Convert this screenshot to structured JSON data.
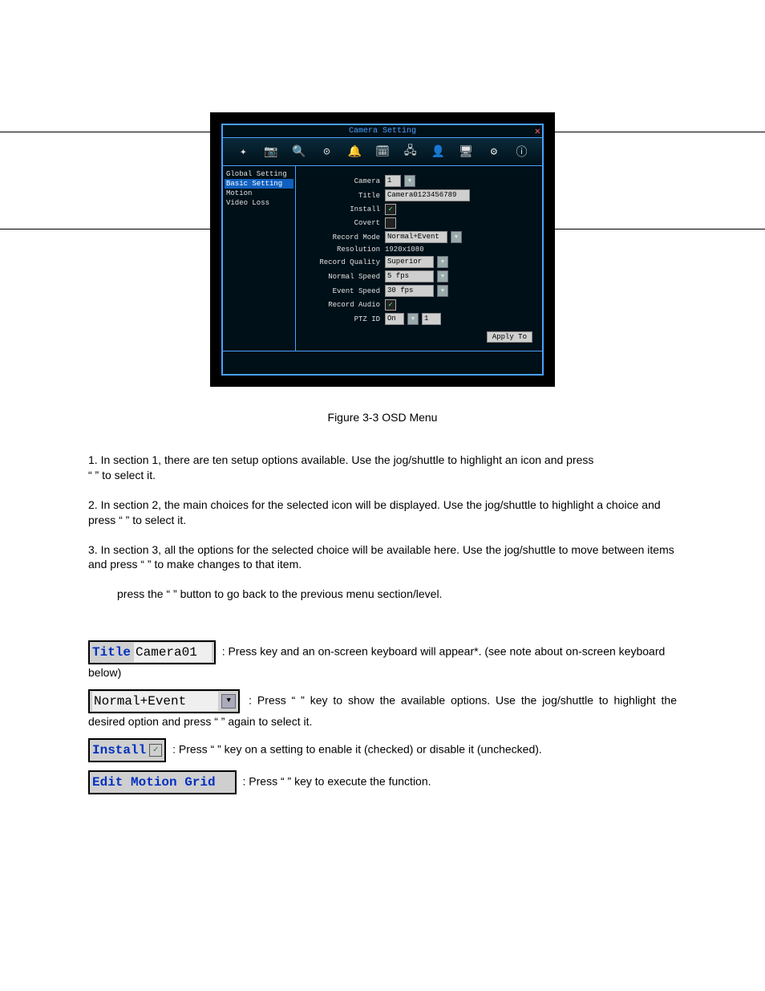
{
  "osd": {
    "title": "Camera Setting",
    "toolbar_icons": [
      {
        "name": "system-icon",
        "glyph": "✦"
      },
      {
        "name": "camera-icon",
        "glyph": "📷"
      },
      {
        "name": "search-icon",
        "glyph": "🔍"
      },
      {
        "name": "record-icon",
        "glyph": "⊙"
      },
      {
        "name": "alarm-icon",
        "glyph": "🔔"
      },
      {
        "name": "schedule-icon",
        "glyph": "🗓"
      },
      {
        "name": "network-icon",
        "glyph": "🖧"
      },
      {
        "name": "user-icon",
        "glyph": "👤"
      },
      {
        "name": "display-icon",
        "glyph": "🖥"
      },
      {
        "name": "config-icon",
        "glyph": "⚙"
      },
      {
        "name": "info-icon",
        "glyph": "ⓘ"
      }
    ],
    "sidebar": [
      {
        "label": "Global Setting",
        "selected": false
      },
      {
        "label": "Basic Setting",
        "selected": true
      },
      {
        "label": "Motion",
        "selected": false
      },
      {
        "label": "Video Loss",
        "selected": false
      }
    ],
    "fields": {
      "camera_label": "Camera",
      "camera_value": "1",
      "title_label": "Title",
      "title_value": "Camera0123456789",
      "install_label": "Install",
      "install_checked": "✓",
      "covert_label": "Covert",
      "covert_checked": "",
      "record_mode_label": "Record Mode",
      "record_mode_value": "Normal+Event",
      "resolution_label": "Resolution",
      "resolution_value": "1920x1080",
      "record_quality_label": "Record Quality",
      "record_quality_value": "Superior",
      "normal_speed_label": "Normal Speed",
      "normal_speed_value": "5 fps",
      "event_speed_label": "Event Speed",
      "event_speed_value": "30 fps",
      "record_audio_label": "Record Audio",
      "record_audio_checked": "✓",
      "ptz_id_label": "PTZ ID",
      "ptz_id_on": "On",
      "ptz_id_value": "1",
      "apply": "Apply To"
    }
  },
  "figure_caption": "Figure 3-3 OSD Menu",
  "paras": {
    "p1a": "1. In section 1, there are ten setup options available. Use the jog/shuttle to highlight an icon and press",
    "p1b": "“        ” to select it.",
    "p2": "2. In section 2, the main choices for the selected icon will be displayed. Use the jog/shuttle to highlight a choice and press “        ” to select it.",
    "p3": "3. In section 3, all the options for the selected choice will be available here. Use the jog/shuttle to move between items and press “        ” to make changes to that item.",
    "p4": "press the “       ” button to go back to the previous menu section/level."
  },
  "chips": {
    "title_label": "Title",
    "title_value": "Camera01",
    "c1a": ": Press ",
    "c1b": " key and an on-screen keyboard will appear*. (see note about on-screen keyboard below)",
    "dropdown_value": "Normal+Event",
    "c2": ":  Press  “        ”  key  to  show  the  available  options.  Use  the jog/shuttle to highlight the desired option and press “        ” again to select it.",
    "install_label": "Install",
    "c3": ": Press “        ” key on a setting to enable it (checked) or disable it (unchecked).",
    "motion_label": "Edit Motion Grid",
    "c4": ": Press “        ” key to execute the function."
  }
}
